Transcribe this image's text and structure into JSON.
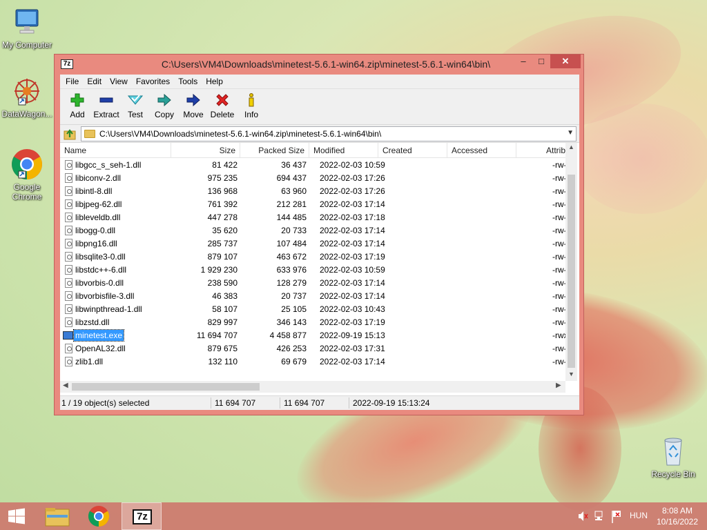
{
  "desktop": {
    "icons": [
      {
        "label": "My Computer"
      },
      {
        "label": "DataWagon..."
      },
      {
        "label": "Google Chrome"
      },
      {
        "label": "Recycle Bin"
      }
    ]
  },
  "window": {
    "app_icon_text": "7z",
    "title": "C:\\Users\\VM4\\Downloads\\minetest-5.6.1-win64.zip\\minetest-5.6.1-win64\\bin\\",
    "controls": {
      "minimize": "–",
      "maximize": "□",
      "close": "✕"
    }
  },
  "menu": [
    "File",
    "Edit",
    "View",
    "Favorites",
    "Tools",
    "Help"
  ],
  "toolbar": {
    "add": "Add",
    "extract": "Extract",
    "test": "Test",
    "copy": "Copy",
    "move": "Move",
    "delete": "Delete",
    "info": "Info"
  },
  "address": {
    "path": "C:\\Users\\VM4\\Downloads\\minetest-5.6.1-win64.zip\\minetest-5.6.1-win64\\bin\\"
  },
  "columns": {
    "name": "Name",
    "size": "Size",
    "packed": "Packed Size",
    "modified": "Modified",
    "created": "Created",
    "accessed": "Accessed",
    "attrib": "Attrib"
  },
  "files": [
    {
      "name": "libgcc_s_seh-1.dll",
      "size": "81 422",
      "packed": "36 437",
      "modified": "2022-02-03 10:59",
      "attrib": "-rw-r"
    },
    {
      "name": "libiconv-2.dll",
      "size": "975 235",
      "packed": "694 437",
      "modified": "2022-02-03 17:26",
      "attrib": "-rw-r"
    },
    {
      "name": "libintl-8.dll",
      "size": "136 968",
      "packed": "63 960",
      "modified": "2022-02-03 17:26",
      "attrib": "-rw-r"
    },
    {
      "name": "libjpeg-62.dll",
      "size": "761 392",
      "packed": "212 281",
      "modified": "2022-02-03 17:14",
      "attrib": "-rw-r"
    },
    {
      "name": "libleveldb.dll",
      "size": "447 278",
      "packed": "144 485",
      "modified": "2022-02-03 17:18",
      "attrib": "-rw-r"
    },
    {
      "name": "libogg-0.dll",
      "size": "35 620",
      "packed": "20 733",
      "modified": "2022-02-03 17:14",
      "attrib": "-rw-r"
    },
    {
      "name": "libpng16.dll",
      "size": "285 737",
      "packed": "107 484",
      "modified": "2022-02-03 17:14",
      "attrib": "-rw-r"
    },
    {
      "name": "libsqlite3-0.dll",
      "size": "879 107",
      "packed": "463 672",
      "modified": "2022-02-03 17:19",
      "attrib": "-rw-r"
    },
    {
      "name": "libstdc++-6.dll",
      "size": "1 929 230",
      "packed": "633 976",
      "modified": "2022-02-03 10:59",
      "attrib": "-rw-r"
    },
    {
      "name": "libvorbis-0.dll",
      "size": "238 590",
      "packed": "128 279",
      "modified": "2022-02-03 17:14",
      "attrib": "-rw-r"
    },
    {
      "name": "libvorbisfile-3.dll",
      "size": "46 383",
      "packed": "20 737",
      "modified": "2022-02-03 17:14",
      "attrib": "-rw-r"
    },
    {
      "name": "libwinpthread-1.dll",
      "size": "58 107",
      "packed": "25 105",
      "modified": "2022-02-03 10:43",
      "attrib": "-rw-r"
    },
    {
      "name": "libzstd.dll",
      "size": "829 997",
      "packed": "346 143",
      "modified": "2022-02-03 17:19",
      "attrib": "-rw-r"
    },
    {
      "name": "minetest.exe",
      "size": "11 694 707",
      "packed": "4 458 877",
      "modified": "2022-09-19 15:13",
      "attrib": "-rwxr",
      "selected": true
    },
    {
      "name": "OpenAL32.dll",
      "size": "879 675",
      "packed": "426 253",
      "modified": "2022-02-03 17:31",
      "attrib": "-rw-r"
    },
    {
      "name": "zlib1.dll",
      "size": "132 110",
      "packed": "69 679",
      "modified": "2022-02-03 17:14",
      "attrib": "-rw-r"
    }
  ],
  "status": {
    "selection": "1 / 19 object(s) selected",
    "size": "11 694 707",
    "packed": "11 694 707",
    "modified": "2022-09-19 15:13:24"
  },
  "taskbar": {
    "lang": "HUN",
    "time": "8:08 AM",
    "date": "10/16/2022",
    "active_app_text": "7z"
  },
  "colors": {
    "accent": "#e98a7f",
    "selection": "#3399ff",
    "taskbar": "#cd786e"
  }
}
